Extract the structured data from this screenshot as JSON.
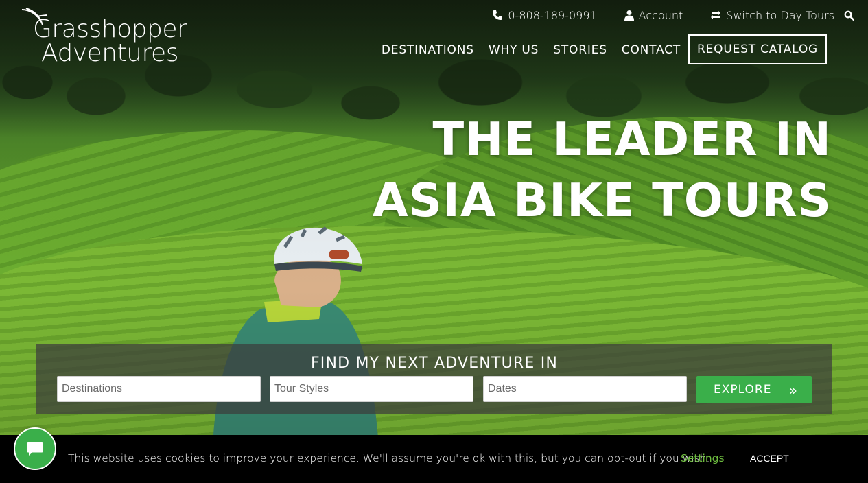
{
  "brand": {
    "logo_line1": "Grasshopper",
    "logo_line2": "Adventures",
    "icon": "grasshopper-logo-icon"
  },
  "utility_bar": {
    "phone": "0-808-189-0991",
    "phone_icon": "phone-icon",
    "account": "Account",
    "account_icon": "user-icon",
    "switch": "Switch to Day Tours",
    "switch_icon": "repeat-icon",
    "search_icon": "search-icon"
  },
  "nav": {
    "items": [
      "DESTINATIONS",
      "WHY US",
      "STORIES",
      "CONTACT"
    ],
    "catalog_button": "REQUEST CATALOG"
  },
  "hero": {
    "headline_line1": "THE LEADER IN",
    "headline_line2": "ASIA BIKE TOURS"
  },
  "finder": {
    "title": "FIND MY NEXT ADVENTURE IN",
    "destinations_placeholder": "Destinations",
    "styles_placeholder": "Tour Styles",
    "dates_placeholder": "Dates",
    "explore_label": "EXPLORE",
    "explore_chevron": "»"
  },
  "cookie": {
    "message": "This website uses cookies to improve your experience. We'll assume you're ok with this, but you can opt-out if you wish.",
    "settings": "Settings",
    "accept": "ACCEPT"
  },
  "chat": {
    "icon": "chat-bubble-icon"
  },
  "colors": {
    "accent_green": "#3aaf4a",
    "settings_green": "#6dbb3f",
    "cookie_bg": "#000000",
    "panel_bg": "rgba(60,60,60,0.72)"
  }
}
